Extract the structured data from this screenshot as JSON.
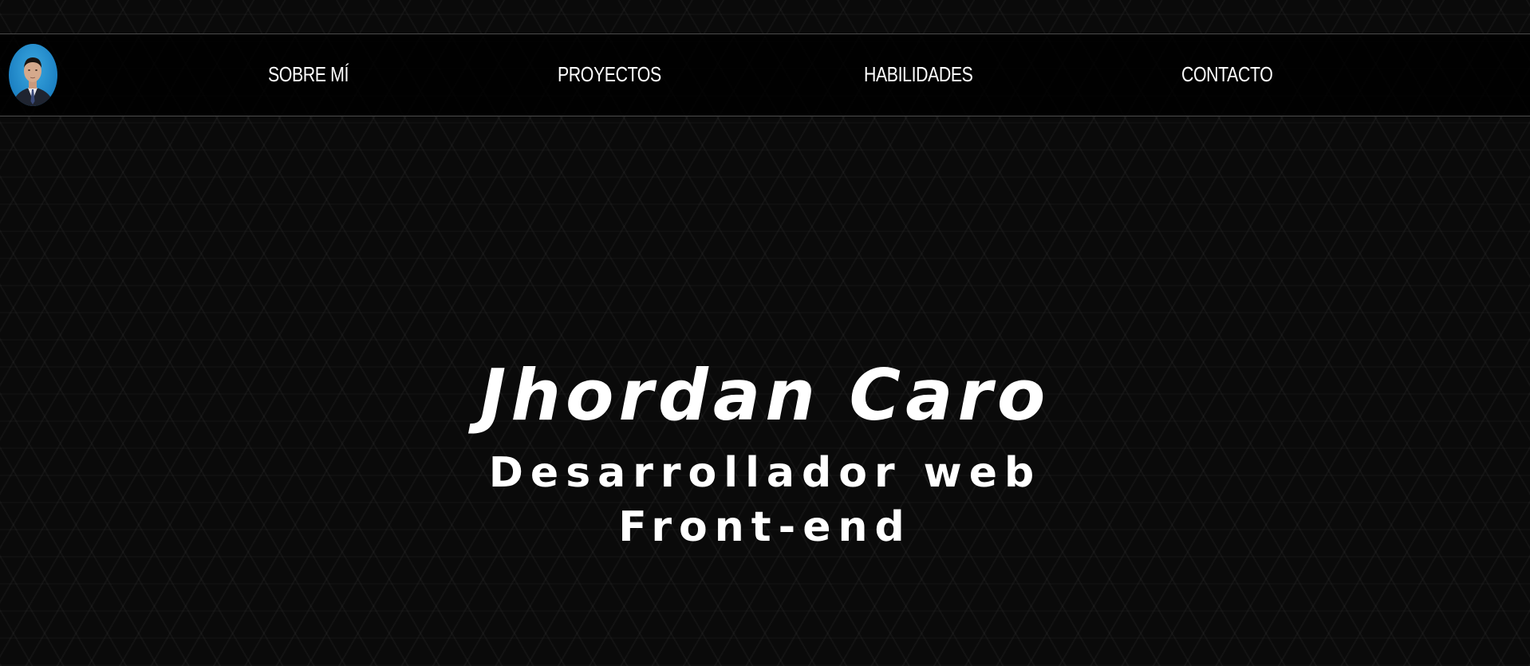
{
  "nav": {
    "items": [
      {
        "label": "SOBRE MÍ"
      },
      {
        "label": "PROYECTOS"
      },
      {
        "label": "HABILIDADES"
      },
      {
        "label": "CONTACTO"
      }
    ]
  },
  "hero": {
    "name": "Jhordan Caro",
    "role_line1": "Desarrollador web",
    "role_line2": "Front-end"
  },
  "colors": {
    "background": "#0a0a0a",
    "text": "#ffffff",
    "avatar_bg": "#1d82c4"
  },
  "icons": {
    "avatar": "profile-photo"
  }
}
